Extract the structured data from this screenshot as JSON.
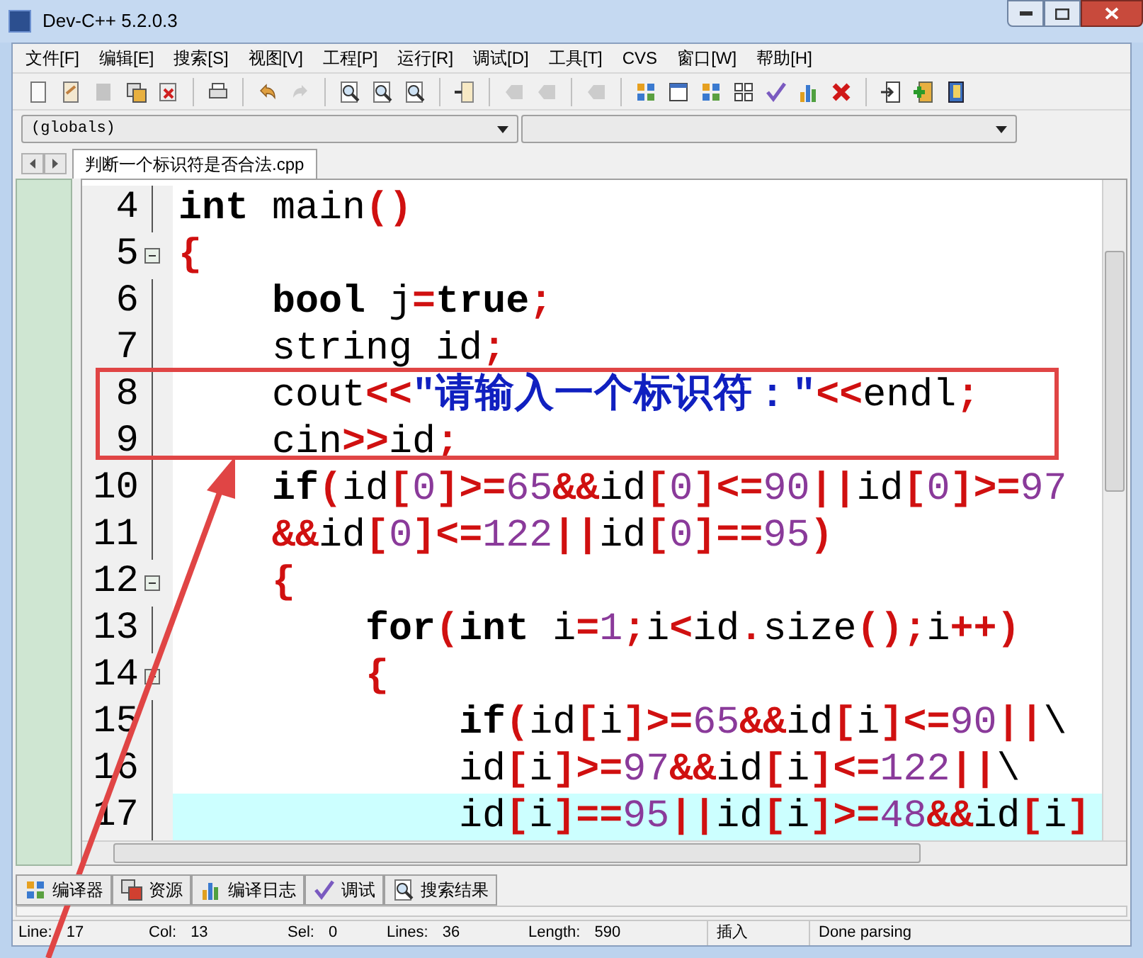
{
  "window": {
    "title": "Dev-C++ 5.2.0.3"
  },
  "menu": [
    "文件[F]",
    "编辑[E]",
    "搜索[S]",
    "视图[V]",
    "工程[P]",
    "运行[R]",
    "调试[D]",
    "工具[T]",
    "CVS",
    "窗口[W]",
    "帮助[H]"
  ],
  "toolbar": [
    {
      "kind": "new",
      "disabled": false
    },
    {
      "kind": "open",
      "disabled": false
    },
    {
      "kind": "save",
      "disabled": true
    },
    {
      "kind": "saveall",
      "disabled": false
    },
    {
      "kind": "close",
      "disabled": false
    },
    {
      "kind": "sep"
    },
    {
      "kind": "print",
      "disabled": false
    },
    {
      "kind": "sep"
    },
    {
      "kind": "undo",
      "disabled": false
    },
    {
      "kind": "redo",
      "disabled": true
    },
    {
      "kind": "sep"
    },
    {
      "kind": "find",
      "disabled": false
    },
    {
      "kind": "find",
      "disabled": false
    },
    {
      "kind": "find",
      "disabled": false
    },
    {
      "kind": "sep"
    },
    {
      "kind": "goto",
      "disabled": false
    },
    {
      "kind": "sep"
    },
    {
      "kind": "bookmark",
      "disabled": true
    },
    {
      "kind": "bookmark",
      "disabled": true
    },
    {
      "kind": "sep"
    },
    {
      "kind": "bookmark",
      "disabled": true
    },
    {
      "kind": "sep"
    },
    {
      "kind": "grid",
      "disabled": false
    },
    {
      "kind": "window",
      "disabled": false
    },
    {
      "kind": "grid",
      "disabled": false
    },
    {
      "kind": "tiles",
      "disabled": false
    },
    {
      "kind": "check",
      "disabled": false
    },
    {
      "kind": "chart",
      "disabled": false
    },
    {
      "kind": "cross",
      "disabled": false
    },
    {
      "kind": "sep"
    },
    {
      "kind": "exit",
      "disabled": false
    },
    {
      "kind": "add",
      "disabled": false
    },
    {
      "kind": "book",
      "disabled": false
    }
  ],
  "selectors": [
    {
      "value": "(globals)"
    }
  ],
  "file_tabs": [
    {
      "label": "判断一个标识符是否合法.cpp",
      "selected": true
    }
  ],
  "code_lines": [
    {
      "number": "4",
      "fold": false,
      "current": false,
      "tokens": [
        {
          "kind": "kw",
          "text": "int"
        },
        {
          "kind": "id",
          "text": " main"
        },
        {
          "kind": "sym",
          "text": "()"
        }
      ]
    },
    {
      "number": "5",
      "fold": true,
      "current": false,
      "tokens": [
        {
          "kind": "sym",
          "text": "{"
        }
      ]
    },
    {
      "number": "6",
      "fold": false,
      "current": false,
      "tokens": [
        {
          "kind": "kw",
          "text": "    bool"
        },
        {
          "kind": "id",
          "text": " j"
        },
        {
          "kind": "sym",
          "text": "="
        },
        {
          "kind": "kw",
          "text": "true"
        },
        {
          "kind": "sym",
          "text": ";"
        }
      ]
    },
    {
      "number": "7",
      "fold": false,
      "current": false,
      "tokens": [
        {
          "kind": "id",
          "text": "    string id"
        },
        {
          "kind": "sym",
          "text": ";"
        }
      ]
    },
    {
      "number": "8",
      "fold": false,
      "current": false,
      "tokens": [
        {
          "kind": "id",
          "text": "    cout"
        },
        {
          "kind": "sym",
          "text": "<<"
        },
        {
          "kind": "str",
          "text": "\"请输入一个标识符：\""
        },
        {
          "kind": "sym",
          "text": "<<"
        },
        {
          "kind": "id",
          "text": "endl"
        },
        {
          "kind": "sym",
          "text": ";"
        }
      ]
    },
    {
      "number": "9",
      "fold": false,
      "current": false,
      "tokens": [
        {
          "kind": "id",
          "text": "    cin"
        },
        {
          "kind": "sym",
          "text": ">>"
        },
        {
          "kind": "id",
          "text": "id"
        },
        {
          "kind": "sym",
          "text": ";"
        }
      ]
    },
    {
      "number": "10",
      "fold": false,
      "current": false,
      "tokens": [
        {
          "kind": "kw",
          "text": "    if"
        },
        {
          "kind": "sym",
          "text": "("
        },
        {
          "kind": "id",
          "text": "id"
        },
        {
          "kind": "sym",
          "text": "["
        },
        {
          "kind": "num",
          "text": "0"
        },
        {
          "kind": "sym",
          "text": "]>="
        },
        {
          "kind": "num",
          "text": "65"
        },
        {
          "kind": "sym",
          "text": "&&"
        },
        {
          "kind": "id",
          "text": "id"
        },
        {
          "kind": "sym",
          "text": "["
        },
        {
          "kind": "num",
          "text": "0"
        },
        {
          "kind": "sym",
          "text": "]<="
        },
        {
          "kind": "num",
          "text": "90"
        },
        {
          "kind": "sym",
          "text": "||"
        },
        {
          "kind": "id",
          "text": "id"
        },
        {
          "kind": "sym",
          "text": "["
        },
        {
          "kind": "num",
          "text": "0"
        },
        {
          "kind": "sym",
          "text": "]>="
        },
        {
          "kind": "num",
          "text": "97"
        }
      ]
    },
    {
      "number": "11",
      "fold": false,
      "current": false,
      "tokens": [
        {
          "kind": "sym",
          "text": "    &&"
        },
        {
          "kind": "id",
          "text": "id"
        },
        {
          "kind": "sym",
          "text": "["
        },
        {
          "kind": "num",
          "text": "0"
        },
        {
          "kind": "sym",
          "text": "]<="
        },
        {
          "kind": "num",
          "text": "122"
        },
        {
          "kind": "sym",
          "text": "||"
        },
        {
          "kind": "id",
          "text": "id"
        },
        {
          "kind": "sym",
          "text": "["
        },
        {
          "kind": "num",
          "text": "0"
        },
        {
          "kind": "sym",
          "text": "]=="
        },
        {
          "kind": "num",
          "text": "95"
        },
        {
          "kind": "sym",
          "text": ")"
        }
      ]
    },
    {
      "number": "12",
      "fold": true,
      "current": false,
      "tokens": [
        {
          "kind": "sym",
          "text": "    {"
        }
      ]
    },
    {
      "number": "13",
      "fold": false,
      "current": false,
      "tokens": [
        {
          "kind": "kw",
          "text": "        for"
        },
        {
          "kind": "sym",
          "text": "("
        },
        {
          "kind": "kw",
          "text": "int"
        },
        {
          "kind": "id",
          "text": " i"
        },
        {
          "kind": "sym",
          "text": "="
        },
        {
          "kind": "num",
          "text": "1"
        },
        {
          "kind": "sym",
          "text": ";"
        },
        {
          "kind": "id",
          "text": "i"
        },
        {
          "kind": "sym",
          "text": "<"
        },
        {
          "kind": "id",
          "text": "id"
        },
        {
          "kind": "sym",
          "text": "."
        },
        {
          "kind": "id",
          "text": "size"
        },
        {
          "kind": "sym",
          "text": "();"
        },
        {
          "kind": "id",
          "text": "i"
        },
        {
          "kind": "sym",
          "text": "++)"
        }
      ]
    },
    {
      "number": "14",
      "fold": true,
      "current": false,
      "tokens": [
        {
          "kind": "sym",
          "text": "        {"
        }
      ]
    },
    {
      "number": "15",
      "fold": false,
      "current": false,
      "tokens": [
        {
          "kind": "kw",
          "text": "            if"
        },
        {
          "kind": "sym",
          "text": "("
        },
        {
          "kind": "id",
          "text": "id"
        },
        {
          "kind": "sym",
          "text": "["
        },
        {
          "kind": "id",
          "text": "i"
        },
        {
          "kind": "sym",
          "text": "]>="
        },
        {
          "kind": "num",
          "text": "65"
        },
        {
          "kind": "sym",
          "text": "&&"
        },
        {
          "kind": "id",
          "text": "id"
        },
        {
          "kind": "sym",
          "text": "["
        },
        {
          "kind": "id",
          "text": "i"
        },
        {
          "kind": "sym",
          "text": "]<="
        },
        {
          "kind": "num",
          "text": "90"
        },
        {
          "kind": "sym",
          "text": "||"
        },
        {
          "kind": "id",
          "text": "\\"
        }
      ]
    },
    {
      "number": "16",
      "fold": false,
      "current": false,
      "tokens": [
        {
          "kind": "id",
          "text": "            id"
        },
        {
          "kind": "sym",
          "text": "["
        },
        {
          "kind": "id",
          "text": "i"
        },
        {
          "kind": "sym",
          "text": "]>="
        },
        {
          "kind": "num",
          "text": "97"
        },
        {
          "kind": "sym",
          "text": "&&"
        },
        {
          "kind": "id",
          "text": "id"
        },
        {
          "kind": "sym",
          "text": "["
        },
        {
          "kind": "id",
          "text": "i"
        },
        {
          "kind": "sym",
          "text": "]<="
        },
        {
          "kind": "num",
          "text": "122"
        },
        {
          "kind": "sym",
          "text": "||"
        },
        {
          "kind": "id",
          "text": "\\"
        }
      ]
    },
    {
      "number": "17",
      "fold": false,
      "current": true,
      "tokens": [
        {
          "kind": "id",
          "text": "            id"
        },
        {
          "kind": "sym",
          "text": "["
        },
        {
          "kind": "id",
          "text": "i"
        },
        {
          "kind": "sym",
          "text": "]=="
        },
        {
          "kind": "num",
          "text": "95"
        },
        {
          "kind": "sym",
          "text": "||"
        },
        {
          "kind": "id",
          "text": "id"
        },
        {
          "kind": "sym",
          "text": "["
        },
        {
          "kind": "id",
          "text": "i"
        },
        {
          "kind": "sym",
          "text": "]>="
        },
        {
          "kind": "num",
          "text": "48"
        },
        {
          "kind": "sym",
          "text": "&&"
        },
        {
          "kind": "id",
          "text": "id"
        },
        {
          "kind": "sym",
          "text": "["
        },
        {
          "kind": "id",
          "text": "i"
        },
        {
          "kind": "sym",
          "text": "]"
        }
      ]
    }
  ],
  "bottom_tabs": [
    {
      "kind": "grid",
      "label": "编译器",
      "selected": false
    },
    {
      "kind": "copies",
      "label": "资源",
      "selected": false
    },
    {
      "kind": "chart",
      "label": "编译日志",
      "selected": false
    },
    {
      "kind": "check",
      "label": "调试",
      "selected": false
    },
    {
      "kind": "find",
      "label": "搜索结果",
      "selected": false
    }
  ],
  "status_bar": {
    "fields": [
      {
        "label": "Line:",
        "value": "17"
      },
      {
        "label": "Col:",
        "value": "13"
      },
      {
        "label": "Sel:",
        "value": "0"
      },
      {
        "label": "Lines:",
        "value": "36"
      },
      {
        "label": "Length:",
        "value": "590"
      }
    ],
    "mode": "插入",
    "message": "Done parsing"
  }
}
